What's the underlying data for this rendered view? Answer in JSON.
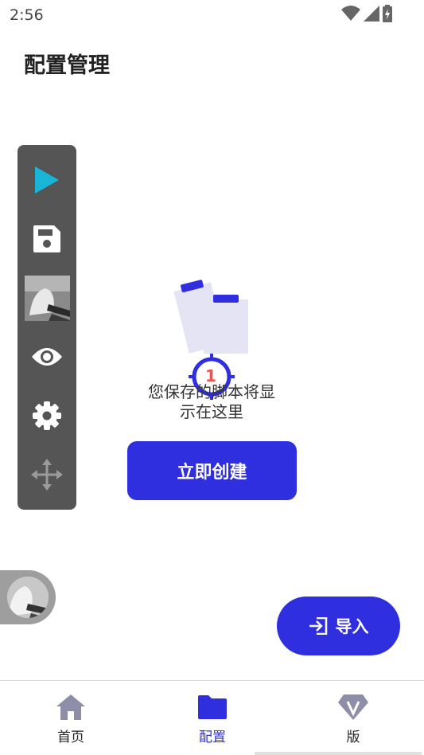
{
  "status_bar": {
    "time": "2:56",
    "icons": [
      "wifi-icon",
      "signal-icon",
      "battery-icon"
    ]
  },
  "page": {
    "title": "配置管理"
  },
  "toolbar": {
    "items": [
      "play-icon",
      "save-icon",
      "screenshot-thumbnail",
      "eye-icon",
      "gear-icon",
      "move-icon"
    ]
  },
  "empty_state": {
    "text_line1": "您保存的脚本将显",
    "text_line2": "示在这里",
    "marker_number": "1"
  },
  "actions": {
    "create_label": "立即创建",
    "import_label": "导入"
  },
  "bottom_nav": {
    "items": [
      {
        "label": "首页",
        "icon": "home-icon"
      },
      {
        "label": "配置",
        "icon": "folder-icon",
        "active": true
      },
      {
        "label": "版",
        "icon": "vip-diamond-icon"
      }
    ]
  },
  "colors": {
    "accent": "#2f2fe0",
    "play": "#19b5d6",
    "toolbar_bg": "#555555",
    "marker_red": "#e53935"
  }
}
